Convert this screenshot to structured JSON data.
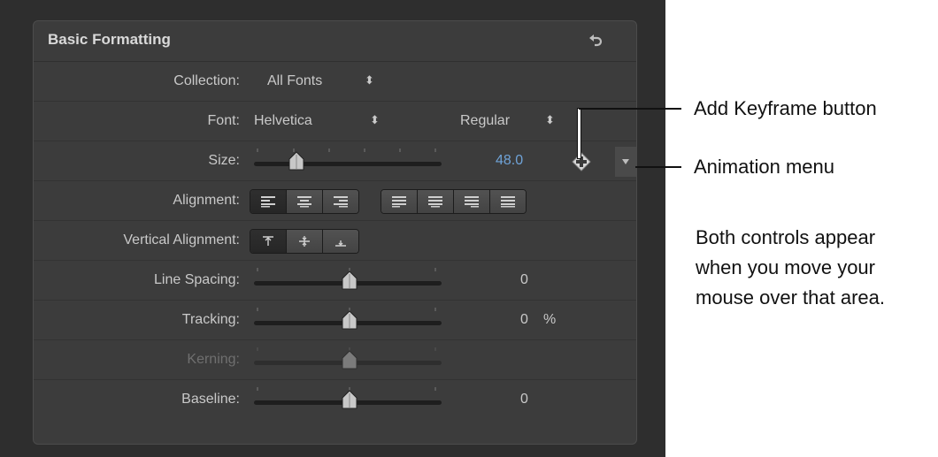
{
  "panel": {
    "title": "Basic Formatting"
  },
  "collection": {
    "label": "Collection:",
    "value": "All Fonts"
  },
  "font": {
    "label": "Font:",
    "family": "Helvetica",
    "style": "Regular"
  },
  "size": {
    "label": "Size:",
    "value": "48.0"
  },
  "alignment": {
    "label": "Alignment:"
  },
  "vertical_alignment": {
    "label": "Vertical Alignment:"
  },
  "line_spacing": {
    "label": "Line Spacing:",
    "value": "0"
  },
  "tracking": {
    "label": "Tracking:",
    "value": "0",
    "unit": "%"
  },
  "kerning": {
    "label": "Kerning:"
  },
  "baseline": {
    "label": "Baseline:",
    "value": "0"
  },
  "annotations": {
    "keyframe": "Add Keyframe button",
    "animation": "Animation menu",
    "note_line1": "Both controls appear",
    "note_line2": "when you move your",
    "note_line3": "mouse over that area."
  },
  "colors": {
    "accent_value": "#6fa3d8",
    "panel_bg": "#3c3c3c"
  },
  "icons": [
    "reset-icon",
    "up-down-arrows-icon",
    "add-keyframe-icon",
    "animation-menu-icon",
    "align-left-icon",
    "align-center-icon",
    "align-right-icon",
    "justify-left-icon",
    "justify-center-icon",
    "justify-right-icon",
    "justify-full-icon",
    "align-top-icon",
    "align-middle-icon",
    "align-bottom-icon"
  ]
}
